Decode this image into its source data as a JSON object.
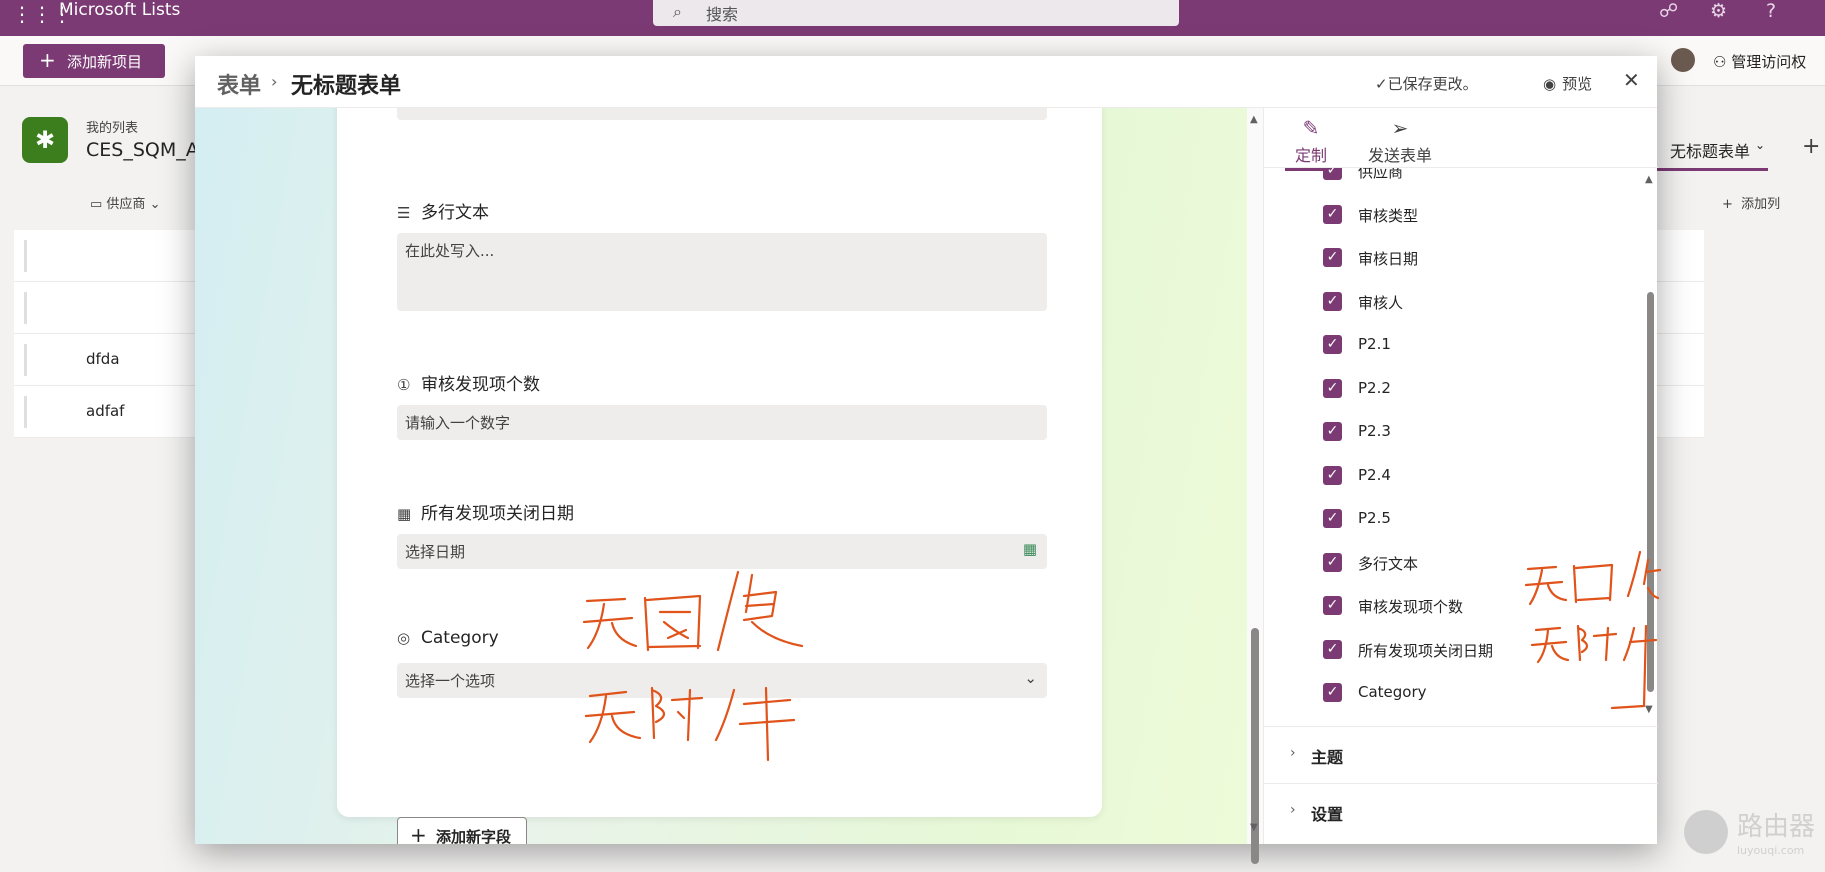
{
  "app": {
    "name": "Microsoft Lists",
    "search_placeholder": "搜索"
  },
  "commandbar": {
    "add_new_item": "添加新项目",
    "manage_access": "管理访问权"
  },
  "list": {
    "my_lists": "我的列表",
    "name": "CES_SQM_A",
    "column_header": "供应商",
    "add_column": "添加列",
    "rows": [
      "dfda",
      "adfaf"
    ],
    "form_tab": "无标题表单"
  },
  "modal": {
    "breadcrumb_root": "表单",
    "breadcrumb_current": "无标题表单",
    "saved_status": "已保存更改。",
    "preview": "预览"
  },
  "form": {
    "fields": [
      {
        "label": "多行文本",
        "icon": "multiline-text-icon",
        "placeholder": "在此处写入..."
      },
      {
        "label": "审核发现项个数",
        "icon": "number-icon",
        "placeholder": "请输入一个数字"
      },
      {
        "label": "所有发现项关闭日期",
        "icon": "calendar-icon",
        "placeholder": "选择日期"
      },
      {
        "label": "Category",
        "icon": "choice-icon",
        "placeholder": "选择一个选项"
      }
    ],
    "add_field": "添加新字段"
  },
  "panel": {
    "tabs": [
      {
        "label": "定制",
        "icon": "customize-icon",
        "active": true
      },
      {
        "label": "发送表单",
        "icon": "send-icon",
        "active": false
      }
    ],
    "field_list": [
      {
        "label": "供应商",
        "checked": true
      },
      {
        "label": "审核类型",
        "checked": true
      },
      {
        "label": "审核日期",
        "checked": true
      },
      {
        "label": "审核人",
        "checked": true
      },
      {
        "label": "P2.1",
        "checked": true
      },
      {
        "label": "P2.2",
        "checked": true
      },
      {
        "label": "P2.3",
        "checked": true
      },
      {
        "label": "P2.4",
        "checked": true
      },
      {
        "label": "P2.5",
        "checked": true
      },
      {
        "label": "多行文本",
        "checked": true
      },
      {
        "label": "审核发现项个数",
        "checked": true
      },
      {
        "label": "所有发现项关闭日期",
        "checked": true
      },
      {
        "label": "Category",
        "checked": true
      }
    ],
    "sections": [
      {
        "label": "主题"
      },
      {
        "label": "设置"
      }
    ]
  },
  "annotations": {
    "left_line1": "无图像",
    "left_line2": "无附件",
    "right_line1": "无图像",
    "right_line2": "无附件",
    "ink_color": "#e0531a"
  },
  "watermark": {
    "text": "路由器",
    "url": "luyouqi.com"
  },
  "colors": {
    "brand": "#7b3a74",
    "checkbox": "#7b3a74"
  }
}
